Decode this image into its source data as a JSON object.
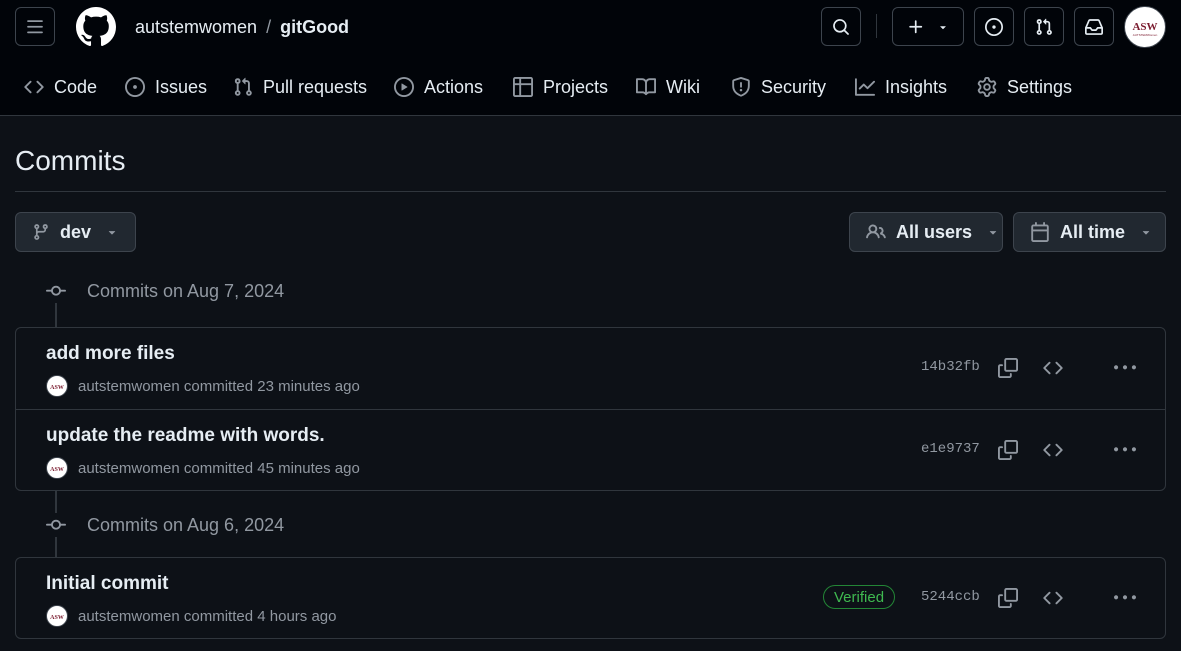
{
  "header": {
    "owner": "autstemwomen",
    "separator": "/",
    "repo": "gitGood",
    "avatar_text": "ASW",
    "avatar_subtext": "AUTSTEMWomen",
    "icons": [
      "menu-icon",
      "github-logo-icon",
      "search-icon",
      "plus-icon",
      "chevron-down-icon",
      "issue-opened-icon",
      "git-pull-request-icon",
      "inbox-icon"
    ]
  },
  "nav": {
    "items": [
      {
        "label": "Code",
        "icon": "code-icon"
      },
      {
        "label": "Issues",
        "icon": "issue-opened-icon"
      },
      {
        "label": "Pull requests",
        "icon": "git-pull-request-icon"
      },
      {
        "label": "Actions",
        "icon": "play-icon"
      },
      {
        "label": "Projects",
        "icon": "table-icon"
      },
      {
        "label": "Wiki",
        "icon": "book-icon"
      },
      {
        "label": "Security",
        "icon": "shield-icon"
      },
      {
        "label": "Insights",
        "icon": "graph-icon"
      },
      {
        "label": "Settings",
        "icon": "gear-icon"
      }
    ]
  },
  "page": {
    "title": "Commits"
  },
  "filters": {
    "branch": "dev",
    "users": "All users",
    "time": "All time"
  },
  "groups": [
    {
      "heading": "Commits on Aug 7, 2024",
      "commits": [
        {
          "message": "add more files",
          "author": "autstemwomen",
          "action": "committed",
          "time": "23 minutes ago",
          "sha": "14b32fb",
          "verified": null
        },
        {
          "message": "update the readme with words.",
          "author": "autstemwomen",
          "action": "committed",
          "time": "45 minutes ago",
          "sha": "e1e9737",
          "verified": null
        }
      ]
    },
    {
      "heading": "Commits on Aug 6, 2024",
      "commits": [
        {
          "message": "Initial commit",
          "author": "autstemwomen",
          "action": "committed",
          "time": "4 hours ago",
          "sha": "5244ccb",
          "verified": "Verified"
        }
      ]
    }
  ],
  "colors": {
    "background": "#0d1117",
    "header_background": "#010409",
    "border": "#30363d",
    "text": "#e6edf3",
    "muted": "#9198a1",
    "verified": "#3fb950"
  }
}
